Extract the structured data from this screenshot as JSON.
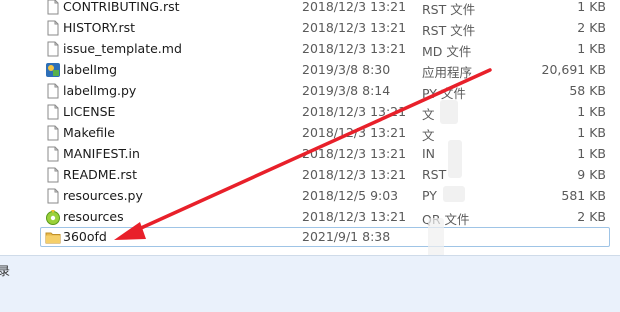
{
  "files": [
    {
      "name": "CONTRIBUTING.rst",
      "date": "2018/12/3 13:21",
      "type": "RST 文件",
      "size": "1 KB",
      "icon": "document-icon"
    },
    {
      "name": "HISTORY.rst",
      "date": "2018/12/3 13:21",
      "type": "RST 文件",
      "size": "2 KB",
      "icon": "document-icon"
    },
    {
      "name": "issue_template.md",
      "date": "2018/12/3 13:21",
      "type": "MD 文件",
      "size": "1 KB",
      "icon": "document-icon"
    },
    {
      "name": "labelImg",
      "date": "2019/3/8 8:30",
      "type": "应用程序",
      "size": "20,691 KB",
      "icon": "application-icon"
    },
    {
      "name": "labelImg.py",
      "date": "2019/3/8 8:14",
      "type": "PY 文件",
      "size": "58 KB",
      "icon": "document-icon"
    },
    {
      "name": "LICENSE",
      "date": "2018/12/3 13:21",
      "type": "文",
      "size": "1 KB",
      "icon": "document-icon"
    },
    {
      "name": "Makefile",
      "date": "2018/12/3 13:21",
      "type": "文",
      "size": "1 KB",
      "icon": "document-icon"
    },
    {
      "name": "MANIFEST.in",
      "date": "2018/12/3 13:21",
      "type": "IN",
      "size": "1 KB",
      "icon": "document-icon"
    },
    {
      "name": "README.rst",
      "date": "2018/12/3 13:21",
      "type": "RST",
      "size": "9 KB",
      "icon": "document-icon"
    },
    {
      "name": "resources.py",
      "date": "2018/12/5 9:03",
      "type": "PY",
      "size": "581 KB",
      "icon": "document-icon"
    },
    {
      "name": "resources",
      "date": "2018/12/3 13:21",
      "type": "QR 文件",
      "size": "2 KB",
      "icon": "qr-resource-icon"
    },
    {
      "name": "360ofd",
      "date": "2021/9/1 8:38",
      "type": "",
      "size": "",
      "icon": "folder-icon"
    }
  ],
  "status": {
    "text": "录"
  },
  "colors": {
    "arrow": "#e8202a",
    "selection_border": "#9fc4e6",
    "status_bg": "#eaf1fb"
  }
}
